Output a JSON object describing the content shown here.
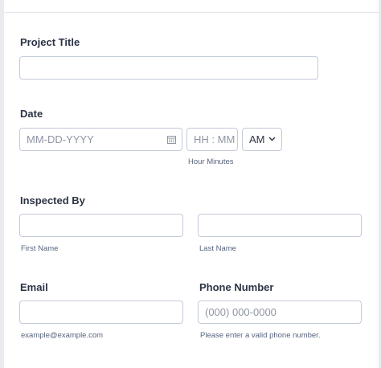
{
  "project_title": {
    "label": "Project Title",
    "value": ""
  },
  "date": {
    "label": "Date",
    "date_placeholder": "MM-DD-YYYY",
    "time_placeholder": "HH : MM",
    "ampm_value": "AM",
    "time_sublabel": "Hour Minutes"
  },
  "inspected_by": {
    "label": "Inspected By",
    "first_sublabel": "First Name",
    "last_sublabel": "Last Name"
  },
  "email": {
    "label": "Email",
    "sublabel": "example@example.com"
  },
  "phone": {
    "label": "Phone Number",
    "placeholder": "(000) 000-0000",
    "sublabel": "Please enter a valid phone number."
  }
}
